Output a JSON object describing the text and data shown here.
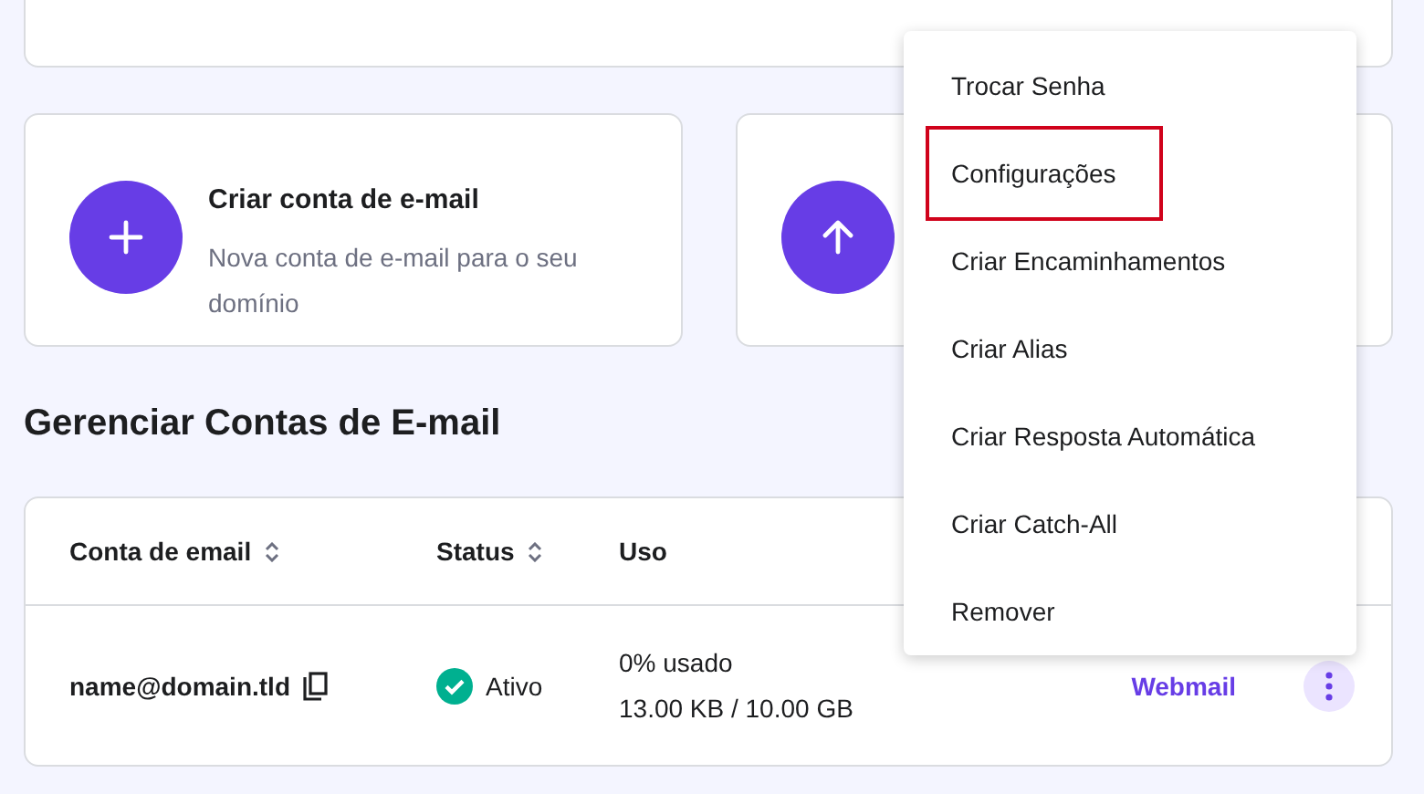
{
  "actions": [
    {
      "kind": "create",
      "title": "Criar conta de e-mail",
      "description": "Nova conta de e-mail para o seu domínio"
    },
    {
      "kind": "upload"
    }
  ],
  "section_title": "Gerenciar Contas de E-mail",
  "table": {
    "columns": [
      {
        "label": "Conta de email",
        "sortable": true
      },
      {
        "label": "Status",
        "sortable": true
      },
      {
        "label": "Uso",
        "sortable": false
      }
    ],
    "rows": [
      {
        "email": "name@domain.tld",
        "status": "Ativo",
        "active": true,
        "usage_percent": "0% usado",
        "usage_amount": "13.00 KB / 10.00 GB",
        "link": "Webmail"
      }
    ]
  },
  "menu": {
    "items": [
      {
        "label": "Trocar Senha",
        "highlighted": false
      },
      {
        "label": "Configurações",
        "highlighted": true
      },
      {
        "label": "Criar Encaminhamentos",
        "highlighted": false
      },
      {
        "label": "Criar Alias",
        "highlighted": false
      },
      {
        "label": "Criar Resposta Automática",
        "highlighted": false
      },
      {
        "label": "Criar Catch-All",
        "highlighted": false
      },
      {
        "label": "Remover",
        "highlighted": false
      }
    ]
  }
}
